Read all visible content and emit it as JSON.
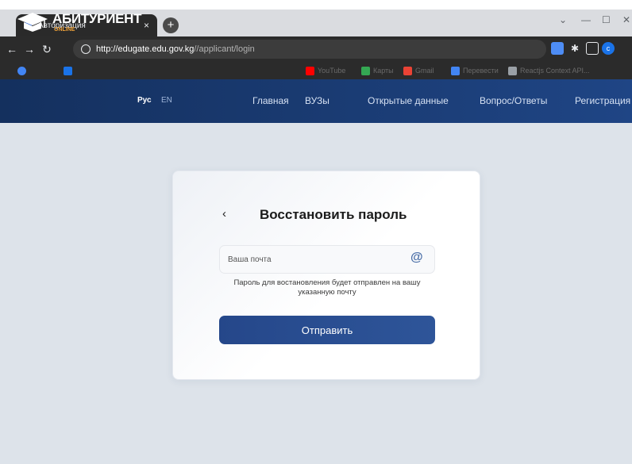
{
  "browser": {
    "tab_title": "Авторизация",
    "tab_close": "×",
    "new_tab": "+",
    "url_host": "http://edugate.edu.gov.kg",
    "url_path": "//applicant/login",
    "profile_initial": "c",
    "window_controls": [
      "⌄",
      "—",
      "☐",
      "✕"
    ]
  },
  "bookmarks": [
    {
      "label": "YouTube",
      "color": "#ff0000"
    },
    {
      "label": "Карты",
      "color": "#34a853"
    },
    {
      "label": "Gmail",
      "color": "#ea4335"
    },
    {
      "label": "Перевести",
      "color": "#4285f4"
    },
    {
      "label": "Reactjs Context API...",
      "color": "#9aa0a6"
    }
  ],
  "site": {
    "logo_text": "АБИТУРИЕНТ",
    "logo_sub": "ONLINE",
    "lang_active": "Рус",
    "lang_inactive": "EN",
    "nav": [
      "Главная",
      "ВУЗы",
      "Открытые данные",
      "Вопрос/Ответы",
      "Регистрация"
    ]
  },
  "form": {
    "back": "‹",
    "title": "Восстановить пароль",
    "email_placeholder": "Ваша почта",
    "at_icon": "@",
    "hint": "Пароль для востановления будет отправлен на вашу указанную почту",
    "submit": "Отправить"
  },
  "colors": {
    "header_start": "#14305e",
    "header_end": "#1f4585",
    "button": "#2a4e90",
    "page_bg": "#dde3ea"
  }
}
